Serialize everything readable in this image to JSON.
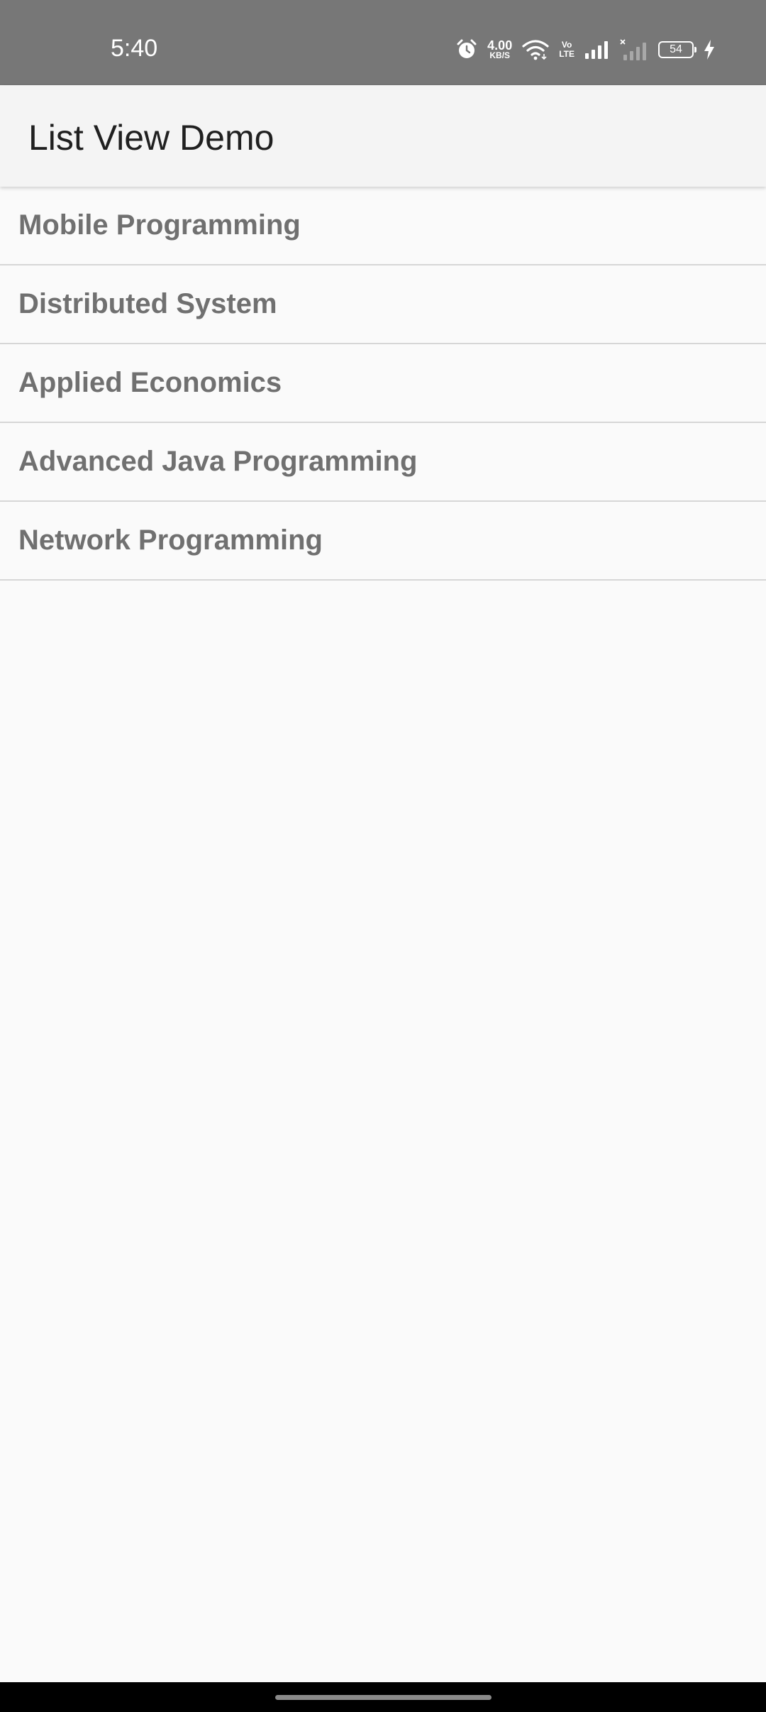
{
  "status_bar": {
    "time": "5:40",
    "net_speed_value": "4.00",
    "net_speed_unit": "KB/S",
    "volte_top": "Vo",
    "volte_bottom": "LTE",
    "battery_level": "54",
    "icons": [
      "alarm-icon",
      "wifi-icon",
      "signal-icon",
      "signal-no-sim-icon",
      "battery-icon",
      "charging-icon"
    ],
    "background_color": "#777777"
  },
  "app_bar": {
    "title": "List View Demo",
    "background_color": "#f4f4f4"
  },
  "list": {
    "items": [
      {
        "label": "Mobile Programming"
      },
      {
        "label": "Distributed System"
      },
      {
        "label": "Applied Economics"
      },
      {
        "label": "Advanced Java Programming"
      },
      {
        "label": "Network Programming"
      }
    ],
    "text_color": "#707070",
    "divider_color": "#d6d6d6"
  }
}
